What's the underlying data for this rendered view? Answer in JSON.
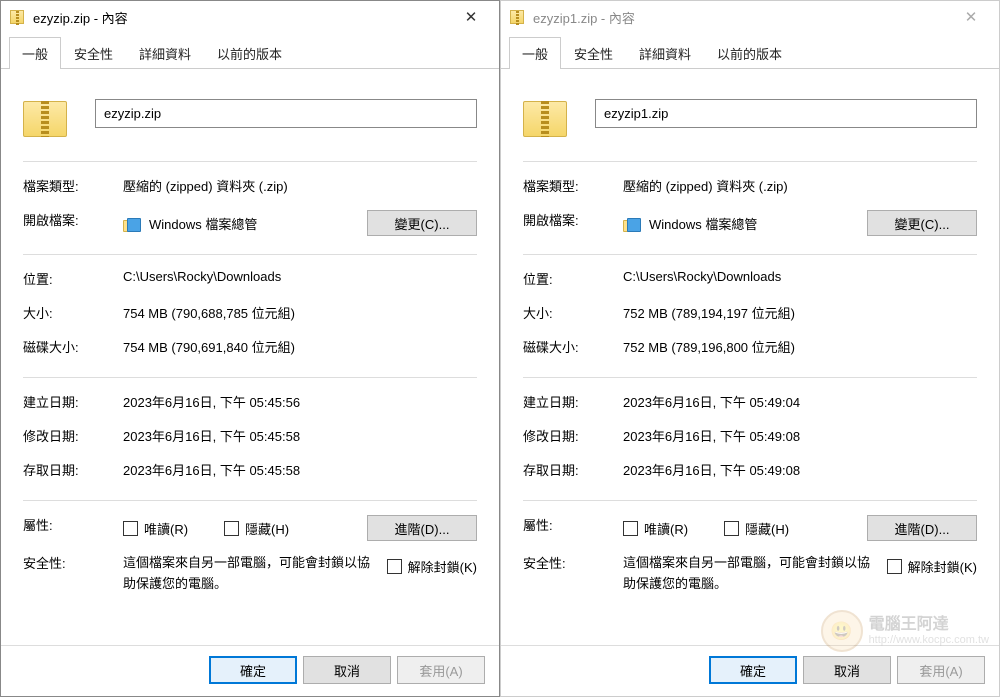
{
  "dialogs": [
    {
      "title": "ezyzip.zip - 內容",
      "active": true,
      "tabs": [
        "一般",
        "安全性",
        "詳細資料",
        "以前的版本"
      ],
      "filename": "ezyzip.zip",
      "fields": {
        "type_label": "檔案類型:",
        "type_value": "壓縮的 (zipped) 資料夾 (.zip)",
        "open_label": "開啟檔案:",
        "open_value": "Windows 檔案總管",
        "change_btn": "變更(C)...",
        "location_label": "位置:",
        "location_value": "C:\\Users\\Rocky\\Downloads",
        "size_label": "大小:",
        "size_value": "754 MB (790,688,785 位元組)",
        "sizedisk_label": "磁碟大小:",
        "sizedisk_value": "754 MB (790,691,840 位元組)",
        "created_label": "建立日期:",
        "created_value": "2023年6月16日, 下午 05:45:56",
        "modified_label": "修改日期:",
        "modified_value": "2023年6月16日, 下午 05:45:58",
        "accessed_label": "存取日期:",
        "accessed_value": "2023年6月16日, 下午 05:45:58",
        "attr_label": "屬性:",
        "readonly": "唯讀(R)",
        "hidden": "隱藏(H)",
        "advanced_btn": "進階(D)...",
        "security_label": "安全性:",
        "security_text": "這個檔案來自另一部電腦，可能會封鎖以協助保護您的電腦。",
        "unblock": "解除封鎖(K)"
      },
      "footer": {
        "ok": "確定",
        "cancel": "取消",
        "apply": "套用(A)"
      }
    },
    {
      "title": "ezyzip1.zip - 內容",
      "active": false,
      "tabs": [
        "一般",
        "安全性",
        "詳細資料",
        "以前的版本"
      ],
      "filename": "ezyzip1.zip",
      "fields": {
        "type_label": "檔案類型:",
        "type_value": "壓縮的 (zipped) 資料夾 (.zip)",
        "open_label": "開啟檔案:",
        "open_value": "Windows 檔案總管",
        "change_btn": "變更(C)...",
        "location_label": "位置:",
        "location_value": "C:\\Users\\Rocky\\Downloads",
        "size_label": "大小:",
        "size_value": "752 MB (789,194,197 位元組)",
        "sizedisk_label": "磁碟大小:",
        "sizedisk_value": "752 MB (789,196,800 位元組)",
        "created_label": "建立日期:",
        "created_value": "2023年6月16日, 下午 05:49:04",
        "modified_label": "修改日期:",
        "modified_value": "2023年6月16日, 下午 05:49:08",
        "accessed_label": "存取日期:",
        "accessed_value": "2023年6月16日, 下午 05:49:08",
        "attr_label": "屬性:",
        "readonly": "唯讀(R)",
        "hidden": "隱藏(H)",
        "advanced_btn": "進階(D)...",
        "security_label": "安全性:",
        "security_text": "這個檔案來自另一部電腦，可能會封鎖以協助保護您的電腦。",
        "unblock": "解除封鎖(K)"
      },
      "footer": {
        "ok": "確定",
        "cancel": "取消",
        "apply": "套用(A)"
      }
    }
  ],
  "watermark": {
    "text": "電腦王阿達",
    "url": "http://www.kocpc.com.tw"
  }
}
